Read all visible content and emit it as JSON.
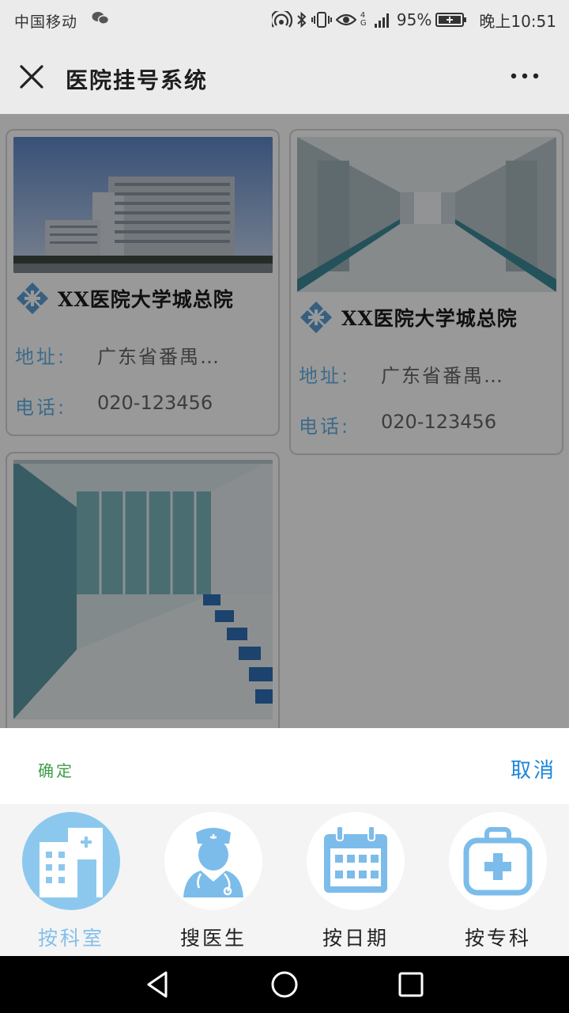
{
  "status_bar": {
    "carrier": "中国移动",
    "network": "4G",
    "battery": "95%",
    "time": "晚上10:51"
  },
  "title_bar": {
    "title": "医院挂号系统",
    "close_icon": "close-icon",
    "more_icon": "more-icon"
  },
  "hospitals": [
    {
      "name": "XX医院大学城总院",
      "address_label": "地址:",
      "address": "广东省番禺…",
      "phone_label": "电话:",
      "phone": "020-123456",
      "photo": "hospital-building-photo"
    },
    {
      "name": "XX医院大学城总院",
      "address_label": "地址:",
      "address": "广东省番禺…",
      "phone_label": "电话:",
      "phone": "020-123456",
      "photo": "hospital-corridor-photo"
    },
    {
      "name": "",
      "photo": "hospital-waiting-hall-photo"
    }
  ],
  "sheet": {
    "confirm": "确定",
    "cancel": "取消",
    "options": [
      {
        "label": "按科室",
        "icon": "building-icon",
        "selected": true
      },
      {
        "label": "搜医生",
        "icon": "doctor-icon",
        "selected": false
      },
      {
        "label": "按日期",
        "icon": "calendar-icon",
        "selected": false
      },
      {
        "label": "按专科",
        "icon": "medical-kit-icon",
        "selected": false
      }
    ]
  },
  "colors": {
    "accent_blue": "#67b3e6",
    "icon_blue": "#7cbcea",
    "confirm_green": "#3e9e48",
    "cancel_blue": "#1e86d8"
  }
}
